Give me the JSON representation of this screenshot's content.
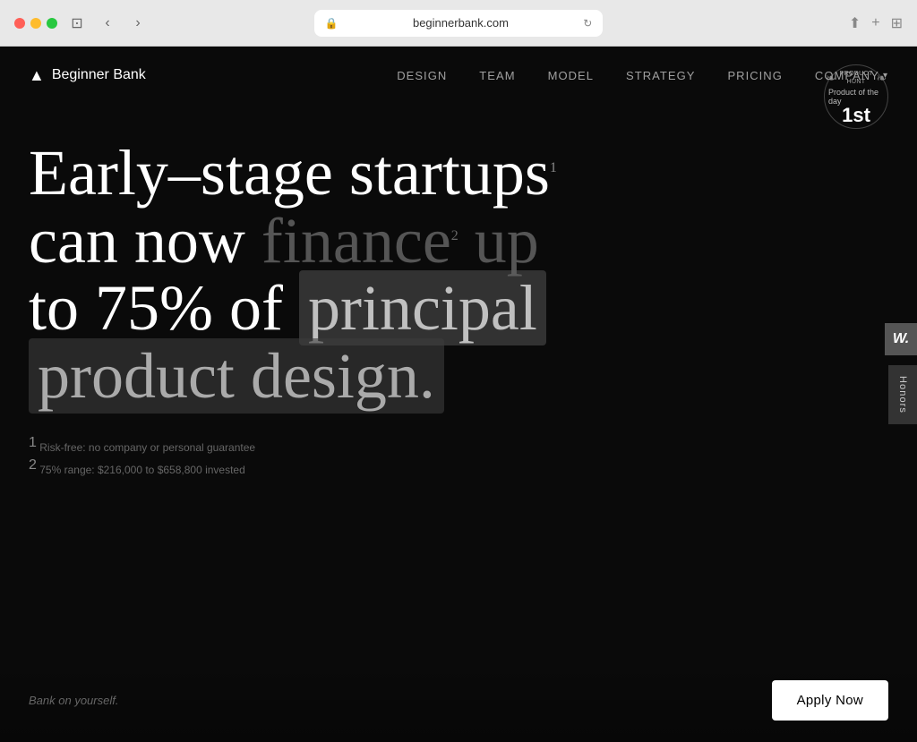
{
  "browser": {
    "url": "beginnerbank.com",
    "back_btn": "‹",
    "forward_btn": "›",
    "refresh_icon": "↻"
  },
  "brand": {
    "icon": "▲",
    "name": "Beginner Bank"
  },
  "nav": {
    "links": [
      {
        "label": "DESIGN",
        "id": "design"
      },
      {
        "label": "TEAM",
        "id": "team"
      },
      {
        "label": "MODEL",
        "id": "model"
      },
      {
        "label": "STRATEGY",
        "id": "strategy"
      },
      {
        "label": "PRICING",
        "id": "pricing"
      },
      {
        "label": "COMPANY",
        "id": "company",
        "has_dropdown": true
      }
    ]
  },
  "product_hunt": {
    "top_label": "PRODUCT HUNT",
    "subtitle": "Product of the day",
    "number": "1st"
  },
  "hero": {
    "line1_a": "Early–stage startups",
    "line1_sup": "1",
    "line2_a": "can now",
    "line2_b": "finance",
    "line2_sup": "2",
    "line2_c": "up",
    "line3_a": "to 75% of",
    "line3_b": "principal",
    "line4_a": "product design."
  },
  "footnotes": [
    {
      "number": "1",
      "text": "Risk-free: no company or personal guarantee"
    },
    {
      "number": "2",
      "text": "75% range: $216,000 to $658,800 invested"
    }
  ],
  "tagline": "Bank on yourself.",
  "cta": {
    "label": "Apply Now"
  },
  "honors_tab": "Honors",
  "w_badge": "W."
}
